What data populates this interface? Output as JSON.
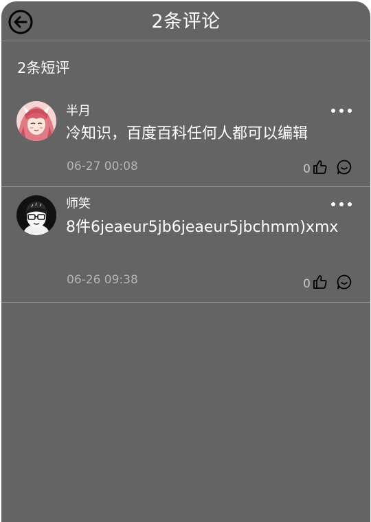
{
  "header": {
    "title": "2条评论",
    "back_icon": "arrow-left-circle-icon"
  },
  "section": {
    "title": "2条短评"
  },
  "comments": [
    {
      "author": "半月",
      "content": "冷知识，百度百科任何人都可以编辑",
      "time": "06-27 00:08",
      "likes": "0",
      "avatar_icon": "anime-girl-avatar"
    },
    {
      "author": "师笑",
      "content": "8件6jeaeur5jb6jeaeur5jbchmm)xmx",
      "time": "06-26 09:38",
      "likes": "0",
      "avatar_icon": "cartoon-boy-avatar"
    }
  ],
  "colors": {
    "background": "#646464",
    "text": "#ffffff",
    "muted": "#b4b4b4",
    "divider": "#9a9a9a"
  }
}
